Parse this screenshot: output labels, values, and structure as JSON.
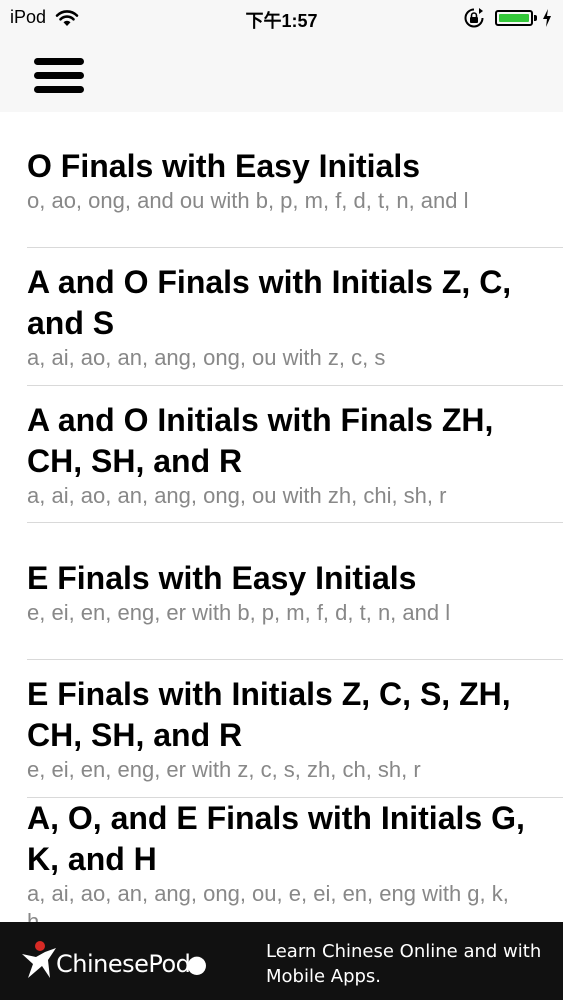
{
  "status_bar": {
    "device": "iPod",
    "time": "下午1:57",
    "battery_color": "#34c83a"
  },
  "nav": {
    "menu_icon": "hamburger-menu-icon"
  },
  "lessons": [
    {
      "title": "O Finals with Easy Initials",
      "subtitle": "o, ao, ong, and ou with b, p, m, f, d, t, n, and l"
    },
    {
      "title": "A and O Finals with Initials Z, C, and S",
      "subtitle": "a, ai, ao, an, ang, ong, ou with z, c, s"
    },
    {
      "title": "A and O Initials with Finals ZH, CH, SH, and R",
      "subtitle": "a, ai, ao, an, ang, ong, ou with zh, chi, sh, r"
    },
    {
      "title": "E Finals with Easy Initials",
      "subtitle": "e, ei, en, eng, er with b, p, m, f, d, t, n, and l"
    },
    {
      "title": "E Finals with Initials Z, C, S, ZH, CH, SH, and R",
      "subtitle": "e, ei, en, eng, er with z, c, s, zh, ch, sh, r"
    },
    {
      "title": "A, O, and E Finals with Initials G, K, and H",
      "subtitle": "a, ai, ao, an, ang, ong, ou, e, ei, en, eng with g, k, h"
    }
  ],
  "banner": {
    "logo_text": "ChinesePod",
    "text": "Learn Chinese Online and with Mobile Apps.",
    "background": "#111111"
  }
}
